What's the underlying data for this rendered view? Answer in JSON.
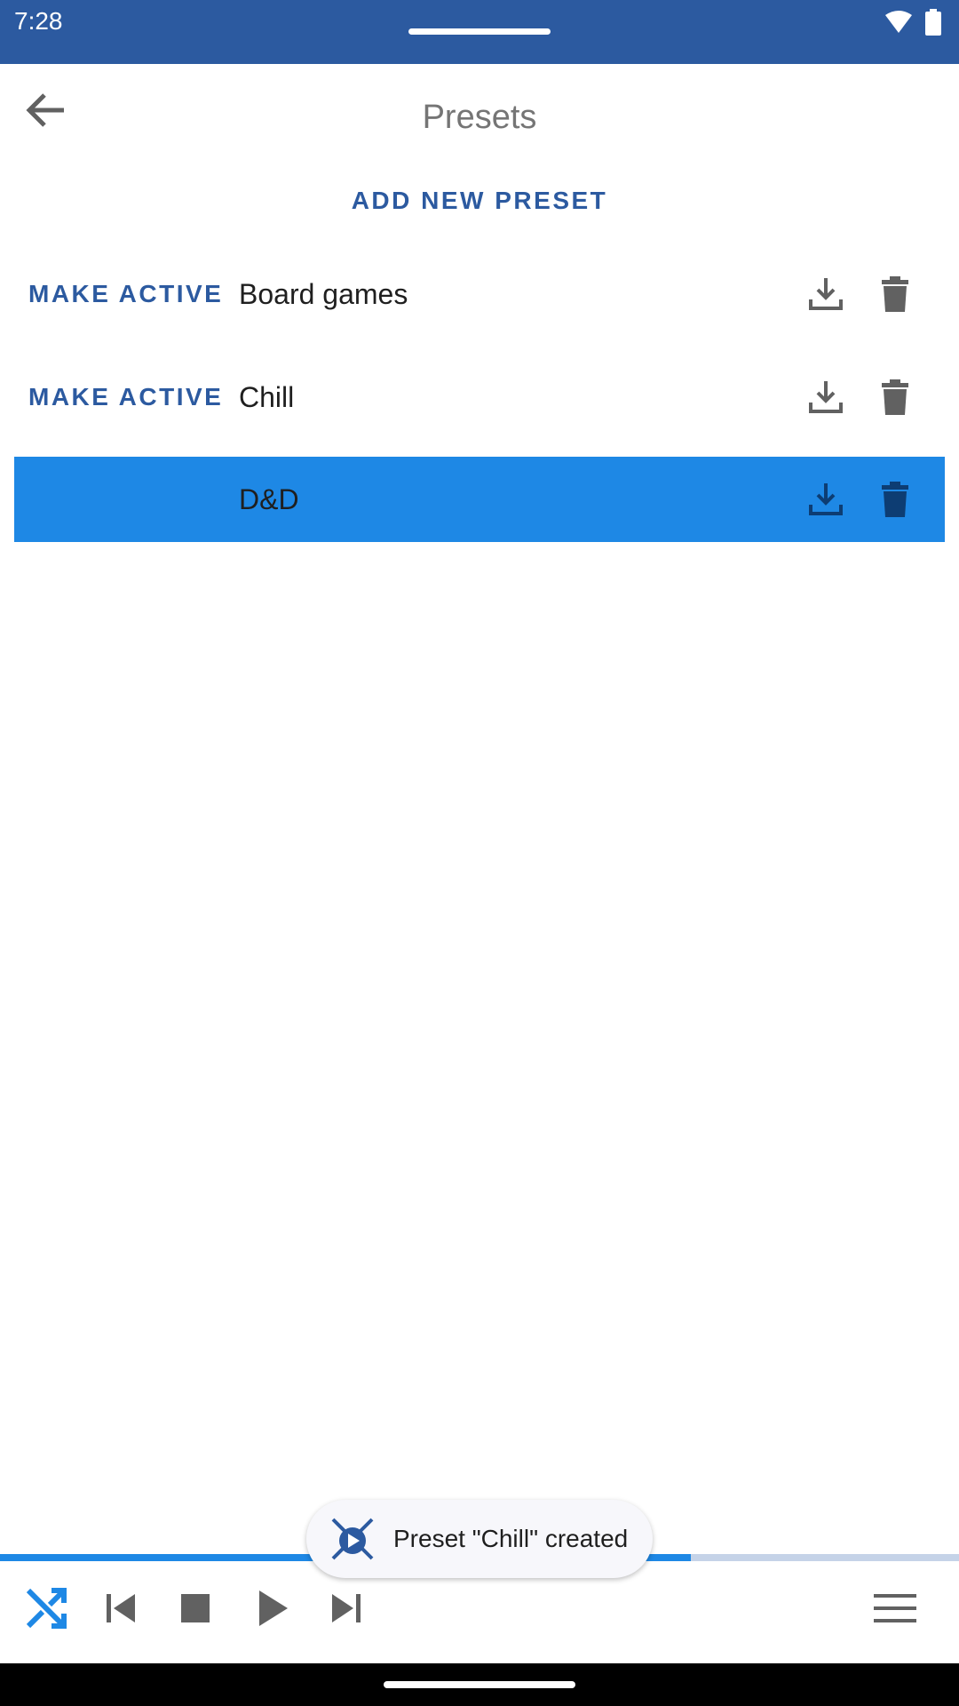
{
  "status_bar": {
    "time": "7:28",
    "icons": [
      "wifi-icon",
      "battery-icon"
    ],
    "color": "#2c5aa0"
  },
  "header": {
    "title": "Presets",
    "back_icon": "arrow-back-icon"
  },
  "add_preset_label": "ADD NEW PRESET",
  "presets": [
    {
      "name": "Board games",
      "make_active_label": "MAKE ACTIVE",
      "active": false
    },
    {
      "name": "Chill",
      "make_active_label": "MAKE ACTIVE",
      "active": false
    },
    {
      "name": "D&D",
      "make_active_label": "",
      "active": true
    }
  ],
  "row_icons": [
    "download-icon",
    "delete-icon"
  ],
  "player": {
    "progress": 0.72,
    "controls": [
      "shuffle-icon",
      "skip-previous-icon",
      "stop-icon",
      "play-icon",
      "skip-next-icon",
      "menu-icon"
    ]
  },
  "toast": {
    "message": "Preset \"Chill\" created",
    "icon": "app-icon"
  },
  "colors": {
    "accent": "#2c5aa0",
    "active_row": "#1e88e5",
    "icon_gray": "#616161",
    "active_icon": "#0d3d73"
  }
}
